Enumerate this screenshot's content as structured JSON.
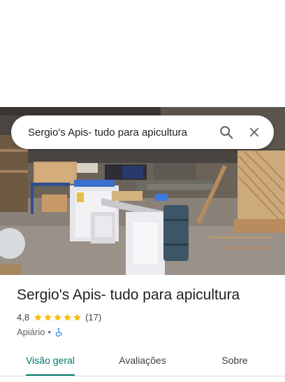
{
  "search": {
    "query": "Sergio's Apis- tudo para apicultura"
  },
  "place": {
    "name": "Sergio's Apis- tudo para apicultura",
    "rating": "4,8",
    "stars": 5,
    "review_count": "(17)",
    "category": "Apiário",
    "separator": "•"
  },
  "tabs": [
    {
      "label": "Visão geral",
      "active": true
    },
    {
      "label": "Avaliações",
      "active": false
    },
    {
      "label": "Sobre",
      "active": false
    }
  ],
  "colors": {
    "accent": "#00796b",
    "star": "#fbbc04",
    "accessibility": "#1a73e8"
  },
  "icons": {
    "search": "search-icon",
    "close": "close-icon",
    "accessible": "wheelchair-icon",
    "star": "star-icon"
  }
}
